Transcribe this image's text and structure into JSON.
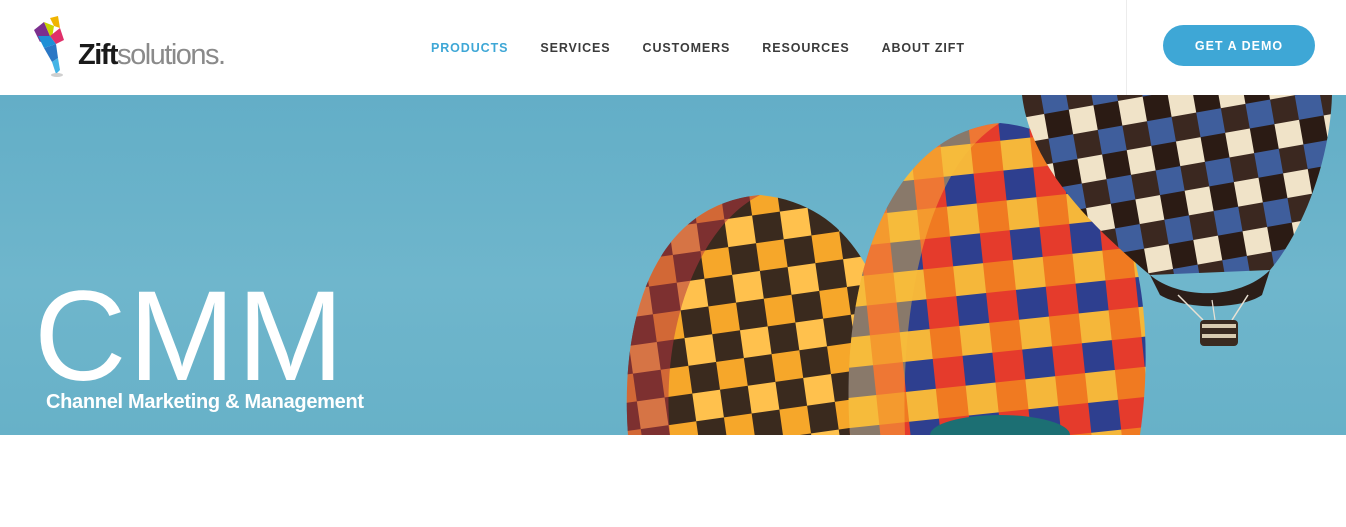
{
  "header": {
    "logo": {
      "brand_strong": "Zift",
      "brand_light": "solutions."
    },
    "nav": [
      {
        "label": "PRODUCTS",
        "active": true
      },
      {
        "label": "SERVICES",
        "active": false
      },
      {
        "label": "CUSTOMERS",
        "active": false
      },
      {
        "label": "RESOURCES",
        "active": false
      },
      {
        "label": "ABOUT ZIFT",
        "active": false
      }
    ],
    "cta_label": "GET A DEMO"
  },
  "hero": {
    "title": "CMM",
    "subtitle": "Channel Marketing & Management"
  },
  "colors": {
    "accent": "#3ea7d6",
    "sky": "#6fb6cc",
    "nav_text": "#3b3b3b"
  }
}
